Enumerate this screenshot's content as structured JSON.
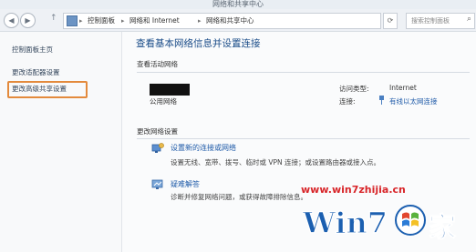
{
  "window": {
    "title": "网络和共享中心"
  },
  "nav": {
    "back": "◀",
    "forward": "▶",
    "up": "↑"
  },
  "address": {
    "crumbs": [
      "控制面板",
      "网络和 Internet",
      "网络和共享中心"
    ],
    "separator": "▸"
  },
  "refresh": "⟳",
  "search": {
    "placeholder": "搜索控制面板",
    "icon": "search-icon"
  },
  "sidebar": {
    "items": [
      {
        "label": "控制面板主页"
      },
      {
        "label": "更改适配器设置"
      },
      {
        "label": "更改高级共享设置",
        "highlighted": true
      }
    ]
  },
  "main": {
    "title": "查看基本网络信息并设置连接",
    "active_networks_label": "查看活动网络",
    "network": {
      "type": "公用网络",
      "access_type_label": "访问类型:",
      "access_type_value": "Internet",
      "connection_label": "连接:",
      "connection_value": "有线以太网连接"
    },
    "change_settings_label": "更改网络设置",
    "tasks": [
      {
        "icon": "network-setup-icon",
        "title": "设置新的连接或网络",
        "description": "设置无线、宽带、拨号、临时或 VPN 连接；或设置路由器或接入点。"
      },
      {
        "icon": "troubleshoot-icon",
        "title": "疑难解答",
        "description": "诊断并修复网络问题，或获得故障排除信息。"
      }
    ]
  },
  "watermark": {
    "url": "www.win7zhijia.cn",
    "brand": "Win7",
    "suffix": "家"
  },
  "colors": {
    "link": "#1e5aa8",
    "title": "#1a4c88",
    "highlight": "#e38a3c",
    "watermark": "#d8262a"
  }
}
